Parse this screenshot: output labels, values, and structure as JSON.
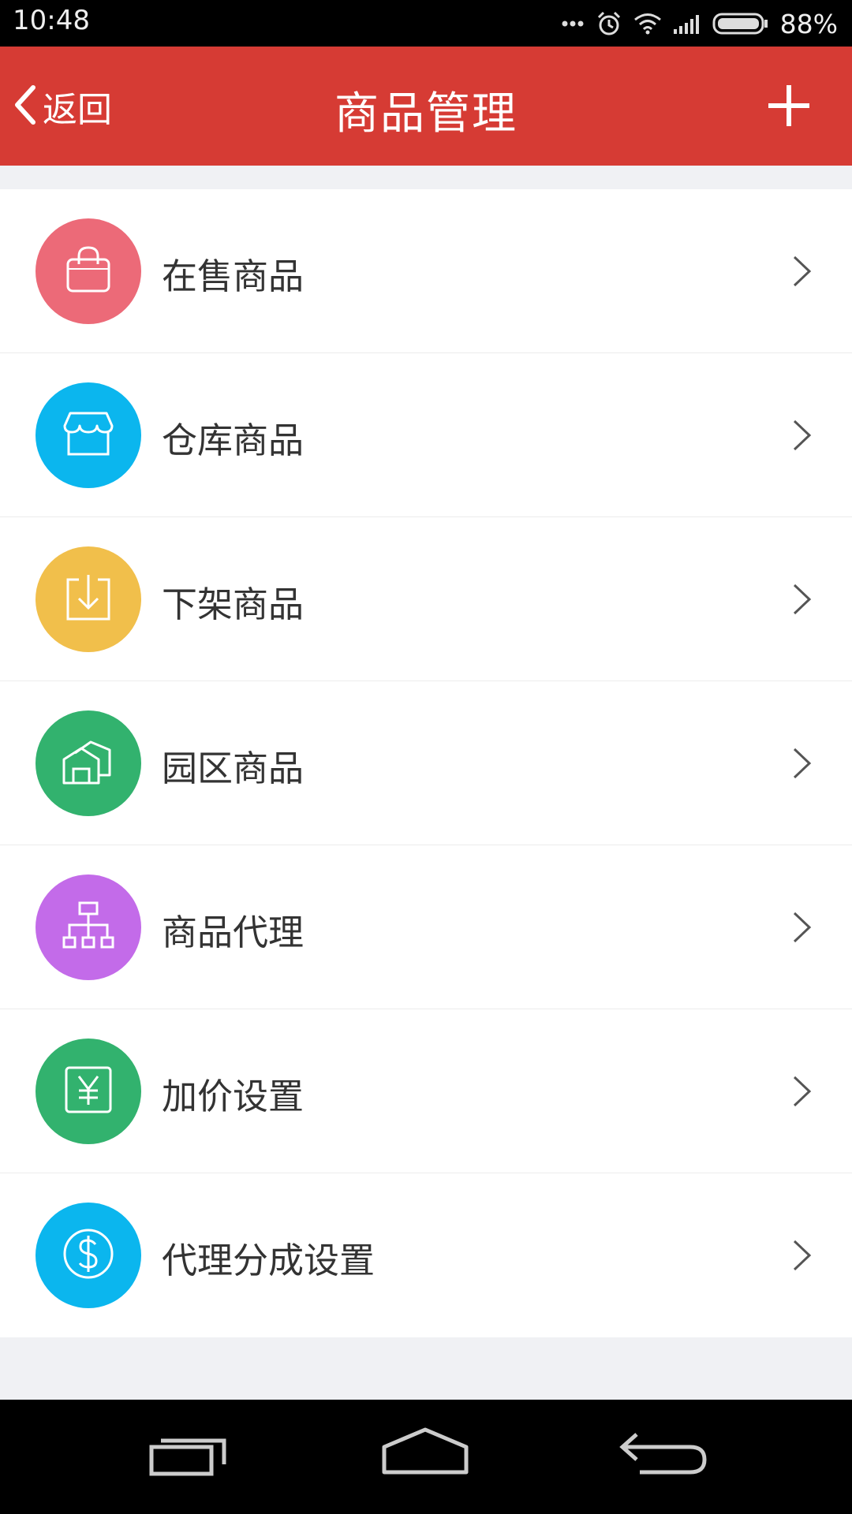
{
  "status": {
    "time": "10:48",
    "battery_percent": "88%",
    "icons": [
      "more-dots-icon",
      "alarm-icon",
      "wifi-icon",
      "signal-icon",
      "battery-icon"
    ]
  },
  "nav": {
    "back_label": "返回",
    "title": "商品管理",
    "add_icon": "plus-icon"
  },
  "menu": [
    {
      "label": "在售商品",
      "icon": "shopping-bag-icon",
      "color": "#ec6a78"
    },
    {
      "label": "仓库商品",
      "icon": "storefront-icon",
      "color": "#0bb6ee"
    },
    {
      "label": "下架商品",
      "icon": "download-tray-icon",
      "color": "#f1bf4b"
    },
    {
      "label": "园区商品",
      "icon": "park-building-icon",
      "color": "#32b26e"
    },
    {
      "label": "商品代理",
      "icon": "org-chart-icon",
      "color": "#c36be9"
    },
    {
      "label": "加价设置",
      "icon": "yen-icon",
      "color": "#32b26e"
    },
    {
      "label": "代理分成设置",
      "icon": "dollar-coin-icon",
      "color": "#0bb6ee"
    }
  ],
  "system_nav": {
    "icons": [
      "recent-apps-icon",
      "home-icon",
      "back-icon"
    ]
  }
}
